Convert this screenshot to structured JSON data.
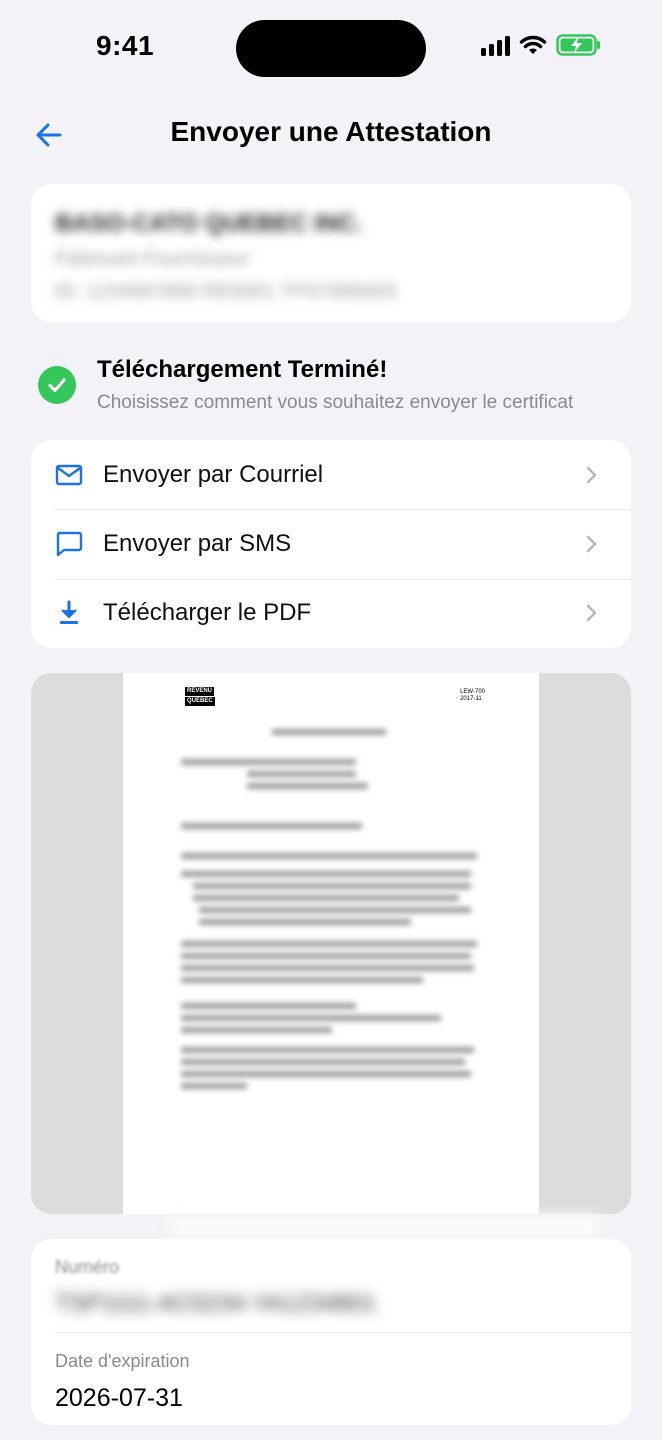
{
  "status_bar": {
    "time": "9:41"
  },
  "nav": {
    "title": "Envoyer une Attestation"
  },
  "company": {
    "name": "BASO-CATO QUEBEC INC.",
    "subtitle": "Fabricant Fournisseur",
    "id_line": "ID: 1234567890 RE0001 TPS7895655"
  },
  "download": {
    "title": "Téléchargement Terminé!",
    "subtitle": "Choisissez comment vous souhaitez envoyer le certificat"
  },
  "options": [
    {
      "label": "Envoyer par Courriel",
      "icon": "mail-icon"
    },
    {
      "label": "Envoyer par SMS",
      "icon": "message-icon"
    },
    {
      "label": "Télécharger le PDF",
      "icon": "download-icon"
    }
  ],
  "document": {
    "logo_line1": "REVENU",
    "logo_line2": "QUÉBEC",
    "ref_code": "LEW-700",
    "ref_date": "2017-11"
  },
  "info": {
    "number_label": "Numéro",
    "number_value": "TSP1111-AC0234-YA1234801",
    "expiry_label": "Date d'expiration",
    "expiry_value": "2026-07-31"
  },
  "colors": {
    "accent": "#1a73e8",
    "success": "#34c759",
    "background": "#f2f2f7"
  }
}
